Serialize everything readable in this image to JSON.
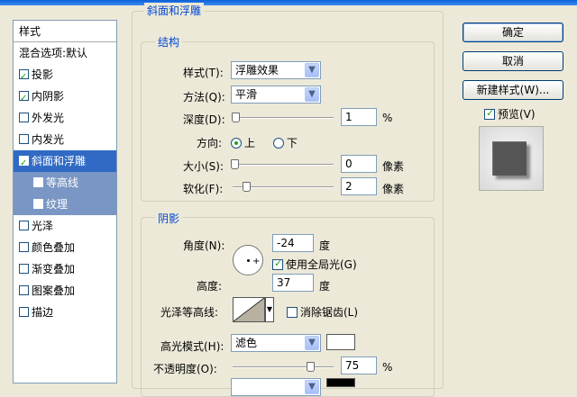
{
  "left_panel": {
    "header": "样式",
    "items": [
      {
        "label": "混合选项:默认",
        "has_checkbox": false,
        "checked": false
      },
      {
        "label": "投影",
        "has_checkbox": true,
        "checked": true
      },
      {
        "label": "内阴影",
        "has_checkbox": true,
        "checked": true
      },
      {
        "label": "外发光",
        "has_checkbox": true,
        "checked": false
      },
      {
        "label": "内发光",
        "has_checkbox": true,
        "checked": false
      },
      {
        "label": "斜面和浮雕",
        "has_checkbox": true,
        "checked": true,
        "selected": true
      },
      {
        "label": "等高线",
        "has_checkbox": true,
        "checked": false
      },
      {
        "label": "纹理",
        "has_checkbox": true,
        "checked": false
      },
      {
        "label": "光泽",
        "has_checkbox": true,
        "checked": false
      },
      {
        "label": "颜色叠加",
        "has_checkbox": true,
        "checked": false
      },
      {
        "label": "渐变叠加",
        "has_checkbox": true,
        "checked": false
      },
      {
        "label": "图案叠加",
        "has_checkbox": true,
        "checked": false
      },
      {
        "label": "描边",
        "has_checkbox": true,
        "checked": false
      }
    ]
  },
  "bevel": {
    "title": "斜面和浮雕",
    "structure": {
      "title": "结构",
      "style_label": "样式(T):",
      "style_value": "浮雕效果",
      "technique_label": "方法(Q):",
      "technique_value": "平滑",
      "depth_label": "深度(D):",
      "depth_value": "1",
      "depth_unit": "%",
      "depth_level": 0.01,
      "direction_label": "方向:",
      "direction_up": "上",
      "direction_down": "下",
      "size_label": "大小(S):",
      "size_value": "0",
      "size_unit": "像素",
      "size_level": 0.0,
      "soften_label": "软化(F):",
      "soften_value": "2",
      "soften_unit": "像素",
      "soften_level": 0.12
    },
    "shading": {
      "title": "阴影",
      "angle_label": "角度(N):",
      "angle_value": "-24",
      "angle_unit": "度",
      "global_light_label": "使用全局光(G)",
      "global_light_checked": true,
      "altitude_label": "高度:",
      "altitude_value": "37",
      "altitude_unit": "度",
      "gloss_contour_label": "光泽等高线:",
      "anti_aliased_label": "消除锯齿(L)",
      "anti_aliased_checked": false,
      "highlight_mode_label": "高光模式(H):",
      "highlight_mode_value": "滤色",
      "highlight_color": "#ffffff",
      "opacity_label": "不透明度(O):",
      "opacity_value": "75",
      "opacity_unit": "%",
      "opacity_level": 0.75,
      "shadow_color": "#000000"
    }
  },
  "buttons": {
    "ok": "确定",
    "cancel": "取消",
    "new_style": "新建样式(W)...",
    "preview_label": "预览(V)",
    "preview_checked": true
  }
}
